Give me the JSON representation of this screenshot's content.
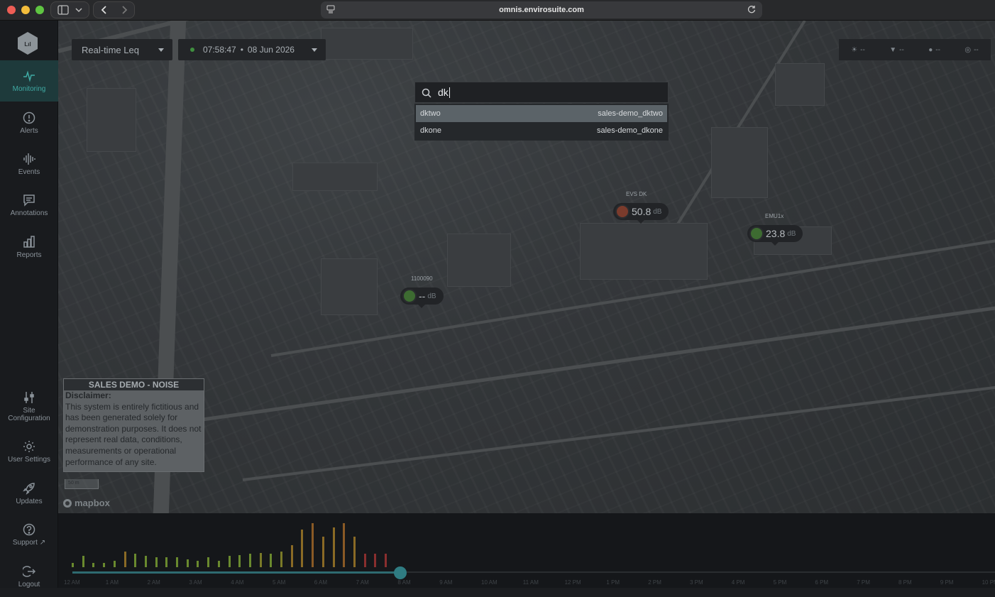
{
  "browser": {
    "url": "omnis.envirosuite.com"
  },
  "sidebar": {
    "items": [
      {
        "label": "Monitoring",
        "icon": "pulse-icon",
        "active": true
      },
      {
        "label": "Alerts",
        "icon": "alert-circle-icon"
      },
      {
        "label": "Events",
        "icon": "waveform-icon"
      },
      {
        "label": "Annotations",
        "icon": "comment-icon"
      },
      {
        "label": "Reports",
        "icon": "bar-chart-icon"
      },
      {
        "label": "Site Configuration",
        "icon": "sliders-icon"
      },
      {
        "label": "User Settings",
        "icon": "gear-icon"
      },
      {
        "label": "Updates",
        "icon": "rocket-icon"
      },
      {
        "label": "Support",
        "icon": "help-circle-icon"
      },
      {
        "label": "Logout",
        "icon": "logout-icon"
      }
    ]
  },
  "toolbar": {
    "mode": "Real-time Leq",
    "time": "07:58:47",
    "separator": "•",
    "date": "08 Jun 2026"
  },
  "weather": {
    "sun": "--",
    "wind": "--",
    "humidity": "--",
    "pressure": "--"
  },
  "search": {
    "query": "dk",
    "results": [
      {
        "name": "dktwo",
        "site": "sales-demo_dktwo"
      },
      {
        "name": "dkone",
        "site": "sales-demo_dkone"
      }
    ]
  },
  "markers": [
    {
      "label": "EVS DK",
      "value": "50.8",
      "unit": "dB",
      "color": "#7a3b2c"
    },
    {
      "label": "EMU1x",
      "value": "23.8",
      "unit": "dB",
      "color": "#3d6b31"
    },
    {
      "label": "1100090",
      "value": "--",
      "unit": "dB",
      "color": "#3d6b31"
    }
  ],
  "disclaimer": {
    "heading": "SALES DEMO - NOISE",
    "subheading": "Disclaimer:",
    "text": "This system is entirely fictitious and has been generated solely for demonstration purposes. It does not represent real data, conditions, measurements or operational performance of any site."
  },
  "map": {
    "scale": "50 m",
    "attribution": "mapbox"
  },
  "timeline": {
    "ticks": [
      "12 AM",
      "1 AM",
      "2 AM",
      "3 AM",
      "4 AM",
      "5 AM",
      "6 AM",
      "7 AM",
      "8 AM",
      "9 AM",
      "10 AM",
      "11 AM",
      "12 PM",
      "1 PM",
      "2 PM",
      "3 PM",
      "4 PM",
      "5 PM",
      "6 PM",
      "7 PM",
      "8 PM",
      "9 PM",
      "10 PM"
    ],
    "bars": [
      {
        "level": 0.1,
        "color": "#6a8a2e"
      },
      {
        "level": 0.25,
        "color": "#6a8a2e"
      },
      {
        "level": 0.1,
        "color": "#6a8a2e"
      },
      {
        "level": 0.1,
        "color": "#6a8a2e"
      },
      {
        "level": 0.15,
        "color": "#6a8a2e"
      },
      {
        "level": 0.35,
        "color": "#8a6a25"
      },
      {
        "level": 0.3,
        "color": "#6a8a2e"
      },
      {
        "level": 0.25,
        "color": "#6a8a2e"
      },
      {
        "level": 0.22,
        "color": "#6a8a2e"
      },
      {
        "level": 0.22,
        "color": "#6a8a2e"
      },
      {
        "level": 0.22,
        "color": "#6a8a2e"
      },
      {
        "level": 0.18,
        "color": "#6a8a2e"
      },
      {
        "level": 0.15,
        "color": "#6a8a2e"
      },
      {
        "level": 0.22,
        "color": "#6a8a2e"
      },
      {
        "level": 0.15,
        "color": "#6a8a2e"
      },
      {
        "level": 0.25,
        "color": "#6a8a2e"
      },
      {
        "level": 0.28,
        "color": "#6a8a2e"
      },
      {
        "level": 0.3,
        "color": "#6a8a2e"
      },
      {
        "level": 0.32,
        "color": "#7a7a28"
      },
      {
        "level": 0.3,
        "color": "#6a8a2e"
      },
      {
        "level": 0.35,
        "color": "#7a7a28"
      },
      {
        "level": 0.5,
        "color": "#8a6a25"
      },
      {
        "level": 0.85,
        "color": "#8a6a25"
      },
      {
        "level": 1.0,
        "color": "#8a5a25"
      },
      {
        "level": 0.7,
        "color": "#8a6a25"
      },
      {
        "level": 0.9,
        "color": "#8a6a25"
      },
      {
        "level": 1.0,
        "color": "#8a5a25"
      },
      {
        "level": 0.7,
        "color": "#8a6a25"
      },
      {
        "level": 0.3,
        "color": "#8a2e2e"
      },
      {
        "level": 0.3,
        "color": "#8a2e2e"
      },
      {
        "level": 0.3,
        "color": "#8a2e2e"
      }
    ],
    "position": 0.355
  }
}
